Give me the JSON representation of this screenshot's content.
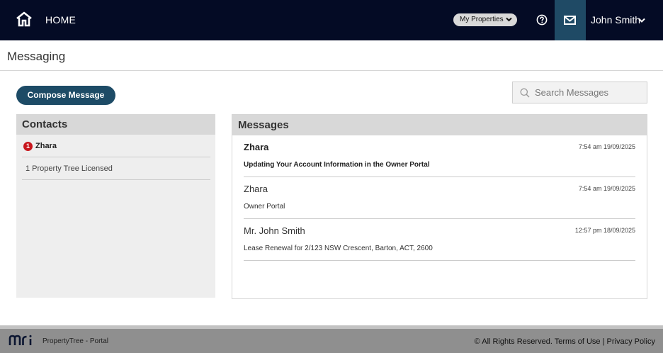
{
  "topbar": {
    "home_label": "HOME",
    "properties_label": "My Properties",
    "user_name": "John Smith",
    "bg_color": "#040b25",
    "mail_active_color": "#1f4a65"
  },
  "subheader": {
    "title": "Messaging"
  },
  "toolbar": {
    "compose_label": "Compose Message",
    "search_placeholder": "Search Messages"
  },
  "contacts": {
    "title": "Contacts",
    "items": [
      {
        "name": "Zhara",
        "unread": "1"
      },
      {
        "name": "1 Property Tree Licensed"
      }
    ]
  },
  "messages": {
    "title": "Messages",
    "items": [
      {
        "sender": "Zhara",
        "time": "7:54 am 19/09/2025",
        "subject": "Updating Your Account Information in the Owner Portal",
        "unread": true
      },
      {
        "sender": "Zhara",
        "time": "7:54 am 19/09/2025",
        "subject": "Owner Portal",
        "unread": false
      },
      {
        "sender": "Mr. John Smith",
        "time": "12:57 pm 18/09/2025",
        "subject": "Lease Renewal for 2/123 NSW Crescent, Barton, ACT, 2600",
        "unread": false
      }
    ]
  },
  "footer": {
    "brand": "PropertyTree - Portal",
    "copyright": "© All Rights Reserved.",
    "terms_label": "Terms of Use",
    "separator": "|",
    "privacy_label": "Privacy Policy"
  },
  "icons": {
    "home": "home-icon",
    "chevron": "chevron-down-icon",
    "help": "help-circle-icon",
    "mail": "envelope-icon",
    "search": "search-icon",
    "logo": "mri-logo"
  },
  "colors": {
    "accent": "#1d4b66",
    "badge": "#c8161d",
    "panel_header": "#d8d8d8",
    "footer": "#8f8f8f"
  }
}
